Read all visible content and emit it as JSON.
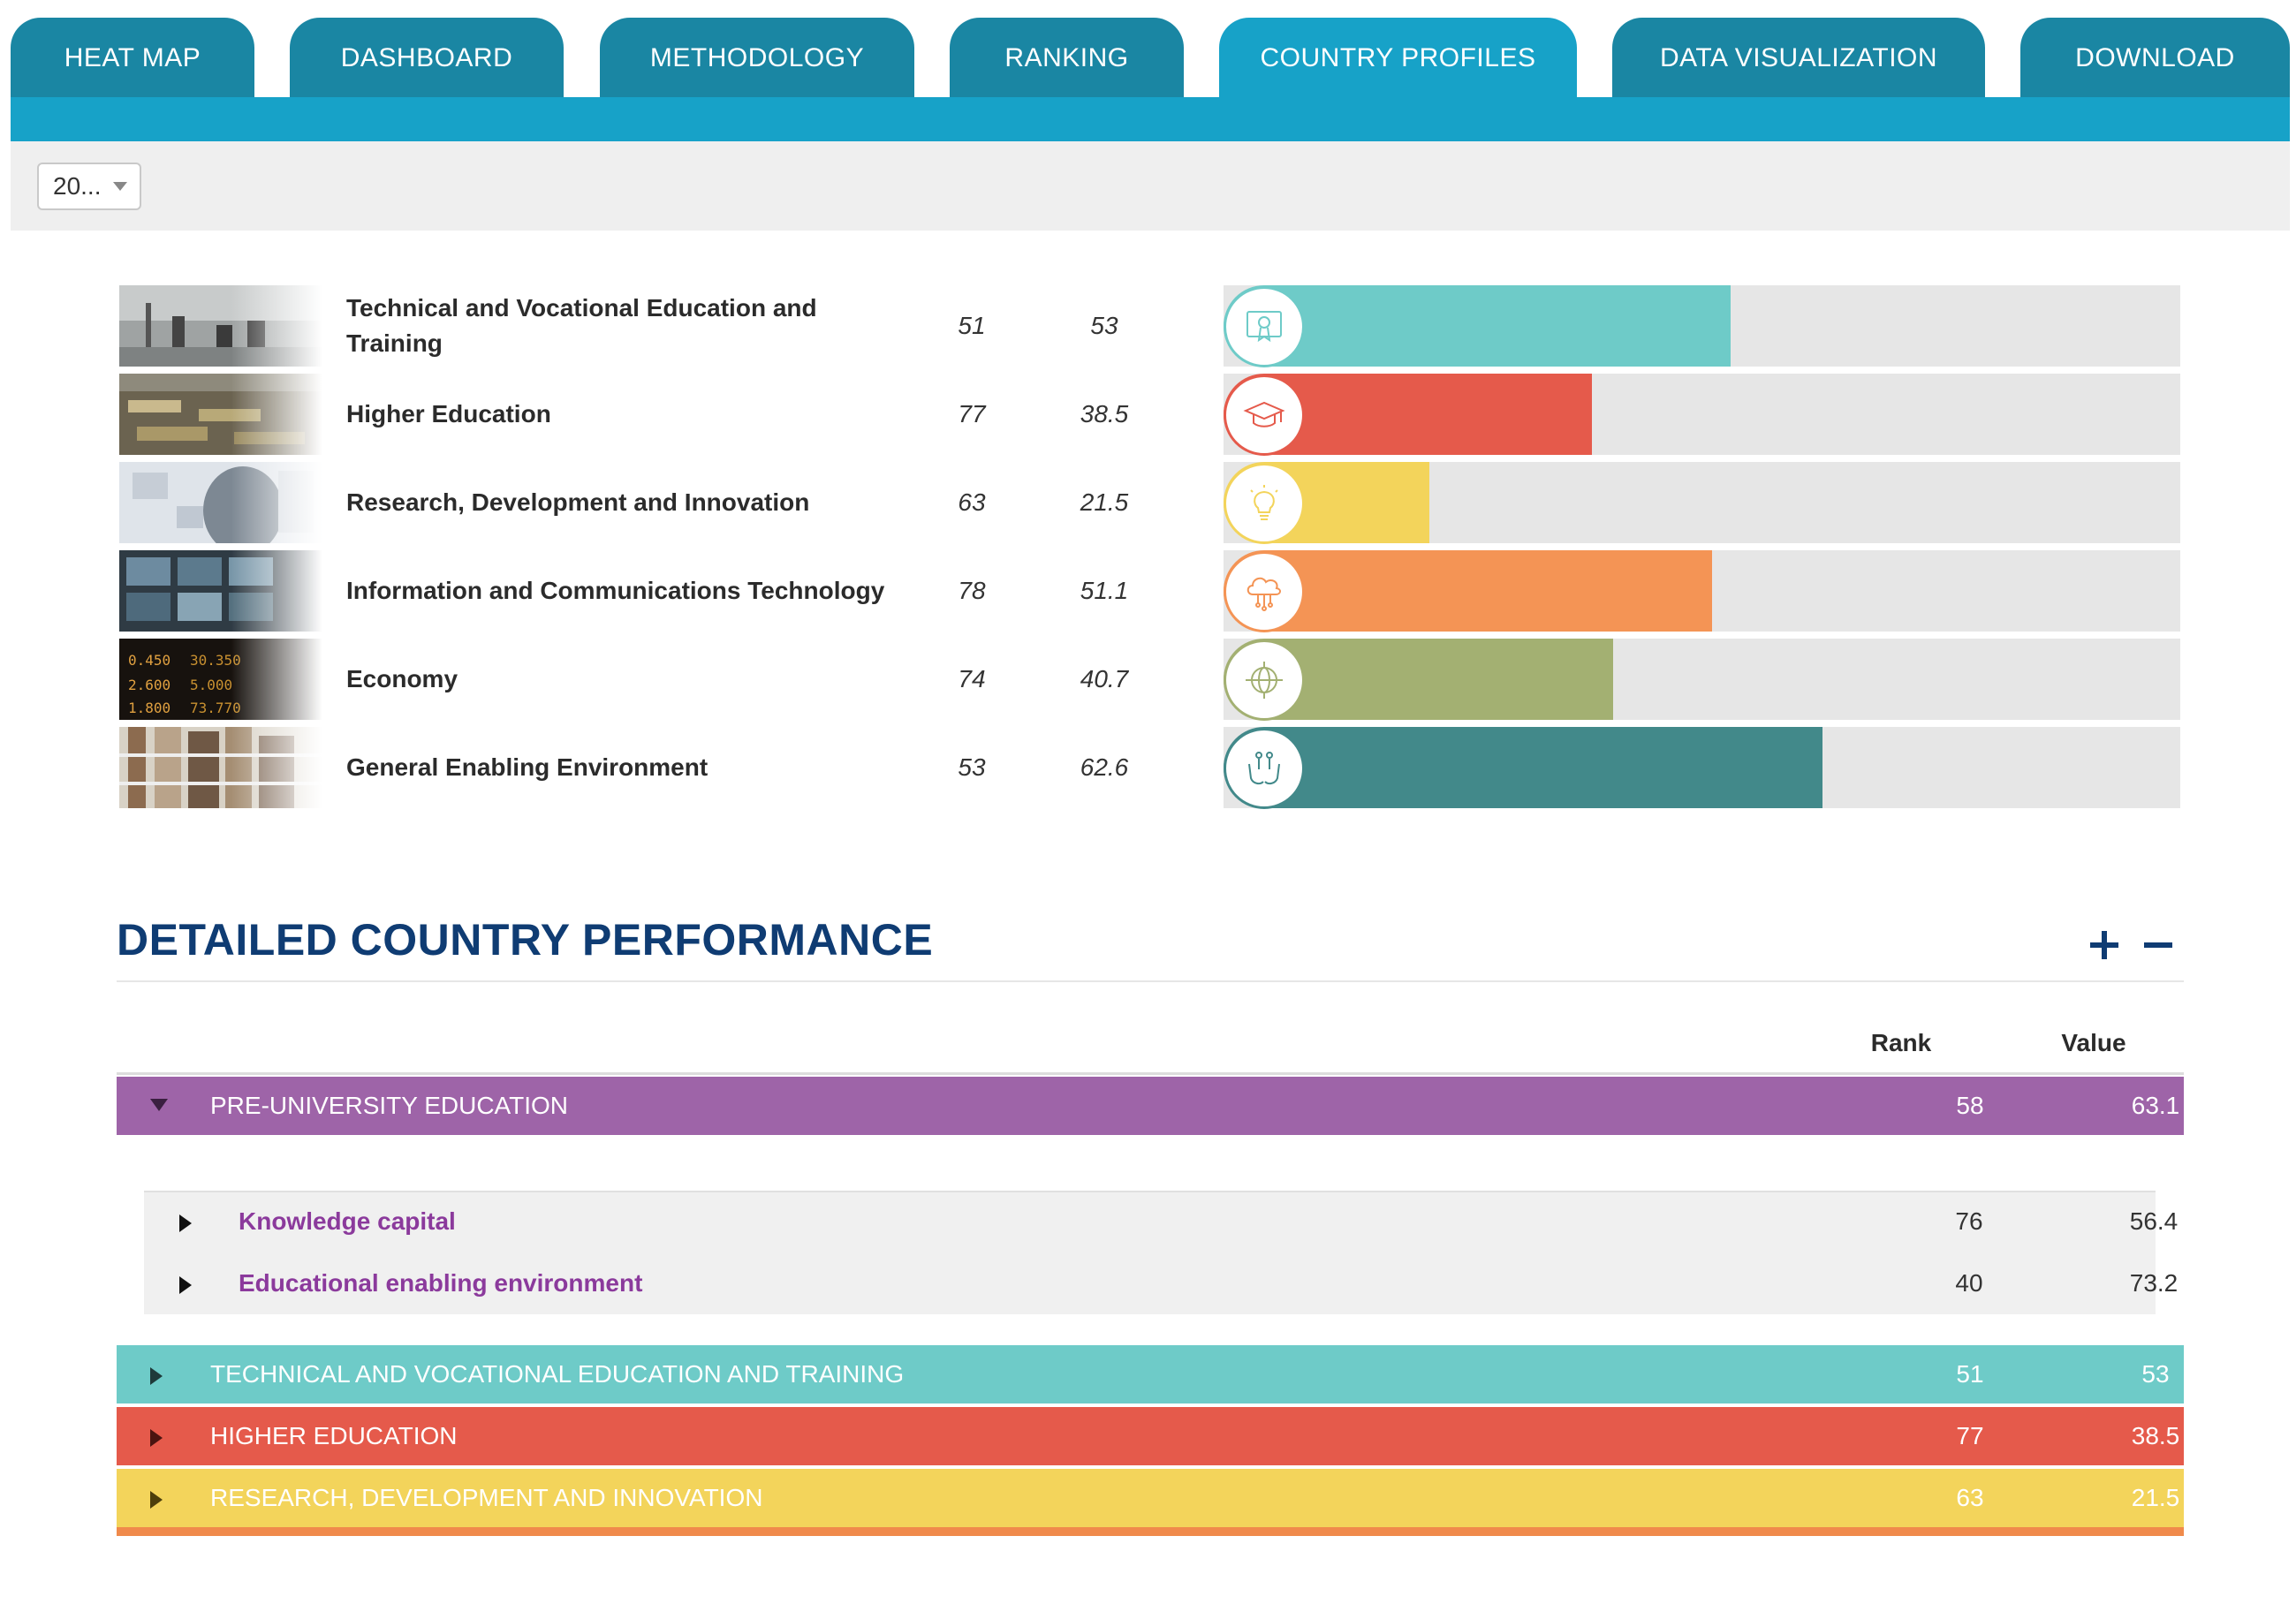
{
  "nav": {
    "tabs": [
      {
        "label": "HEAT MAP",
        "active": false
      },
      {
        "label": "DASHBOARD",
        "active": false
      },
      {
        "label": "METHODOLOGY",
        "active": false
      },
      {
        "label": "RANKING",
        "active": false
      },
      {
        "label": "COUNTRY PROFILES",
        "active": true
      },
      {
        "label": "DATA VISUALIZATION",
        "active": false
      },
      {
        "label": "DOWNLOAD",
        "active": false
      }
    ]
  },
  "filter": {
    "year_selected": "20..."
  },
  "pillars": [
    {
      "name": "Technical and Vocational Education and Training",
      "rank": "51",
      "value": "53",
      "score": 53,
      "color": "#6ecbc8",
      "icon": "certificate-icon",
      "image": "workshop-photo"
    },
    {
      "name": "Higher Education",
      "rank": "77",
      "value": "38.5",
      "score": 38.5,
      "color": "#e55a4b",
      "icon": "graduation-cap-icon",
      "image": "lecture-hall-photo"
    },
    {
      "name": "Research, Development and Innovation",
      "rank": "63",
      "value": "21.5",
      "score": 21.5,
      "color": "#f3d45b",
      "icon": "lightbulb-icon",
      "image": "researcher-photo"
    },
    {
      "name": "Information and Communications Technology",
      "rank": "78",
      "value": "51.1",
      "score": 51.1,
      "color": "#f49455",
      "icon": "cloud-network-icon",
      "image": "monitors-photo"
    },
    {
      "name": "Economy",
      "rank": "74",
      "value": "40.7",
      "score": 40.7,
      "color": "#a3b072",
      "icon": "globe-icon",
      "image": "stock-ticker-photo"
    },
    {
      "name": "General Enabling Environment",
      "rank": "53",
      "value": "62.6",
      "score": 62.6,
      "color": "#42898a",
      "icon": "hands-people-icon",
      "image": "library-photo"
    }
  ],
  "detailed": {
    "title": "DETAILED COUNTRY PERFORMANCE",
    "col_rank": "Rank",
    "col_value": "Value",
    "categories": [
      {
        "label": "PRE-UNIVERSITY EDUCATION",
        "rank": "58",
        "value": "63.1",
        "color": "#9e64a8",
        "expanded": true
      },
      {
        "label": "TECHNICAL AND VOCATIONAL EDUCATION AND TRAINING",
        "rank": "51",
        "value": "53",
        "color": "#6ecbc8",
        "expanded": false
      },
      {
        "label": "HIGHER EDUCATION",
        "rank": "77",
        "value": "38.5",
        "color": "#e55a4b",
        "expanded": false
      },
      {
        "label": "RESEARCH, DEVELOPMENT AND INNOVATION",
        "rank": "63",
        "value": "21.5",
        "color": "#f3d45b",
        "expanded": false
      }
    ],
    "subitems": [
      {
        "label": "Knowledge capital",
        "rank": "76",
        "value": "56.4"
      },
      {
        "label": "Educational enabling environment",
        "rank": "40",
        "value": "73.2"
      }
    ]
  }
}
